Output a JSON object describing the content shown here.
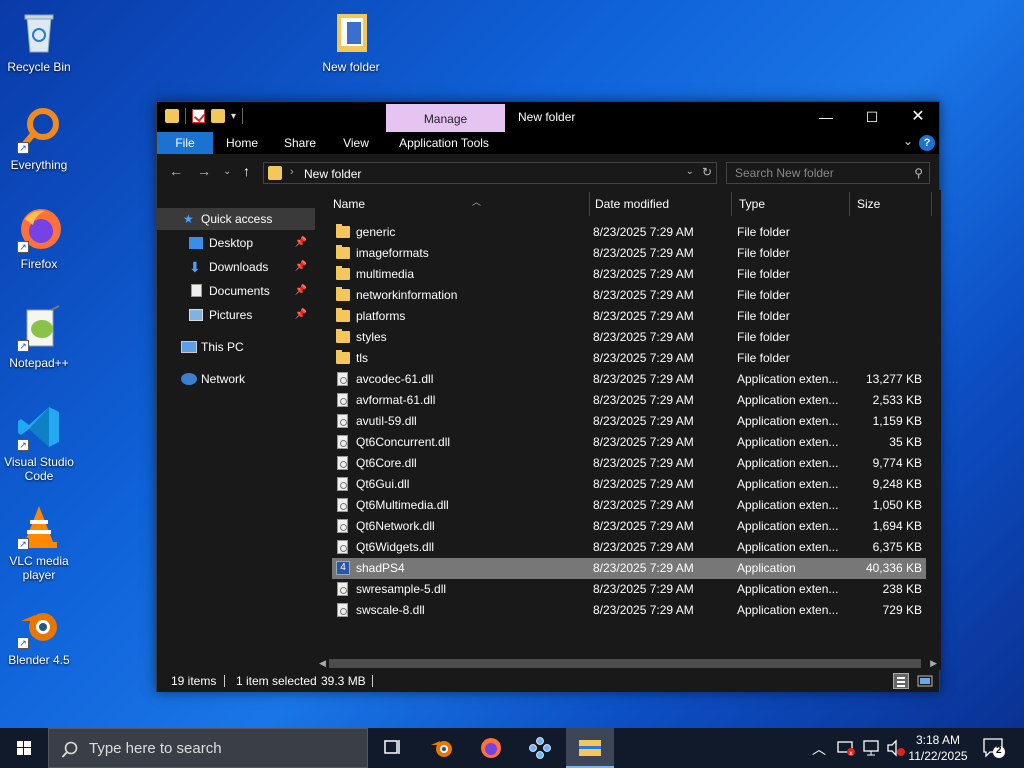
{
  "desktop_icons": [
    {
      "label": "Recycle Bin",
      "icon": "recycle-bin-icon"
    },
    {
      "label": "New folder",
      "icon": "folder-icon"
    },
    {
      "label": "Everything",
      "icon": "everything-search-icon"
    },
    {
      "label": "Firefox",
      "icon": "firefox-icon"
    },
    {
      "label": "Notepad++",
      "icon": "notepadpp-icon"
    },
    {
      "label": "Visual Studio Code",
      "icon": "vscode-icon"
    },
    {
      "label": "VLC media player",
      "icon": "vlc-icon"
    },
    {
      "label": "Blender 4.5",
      "icon": "blender-icon"
    }
  ],
  "window": {
    "title": "New folder",
    "manage_tab": "Manage",
    "ribbon_tabs": [
      "File",
      "Home",
      "Share",
      "View",
      "Application Tools"
    ],
    "address_crumb": "New folder",
    "search_placeholder": "Search New folder",
    "help_glyph": "?"
  },
  "nav_pane": {
    "items": [
      {
        "label": "Quick access",
        "icon": "star-icon",
        "selected": true
      },
      {
        "label": "Desktop",
        "icon": "desktop-icon",
        "pinned": true
      },
      {
        "label": "Downloads",
        "icon": "download-icon",
        "pinned": true
      },
      {
        "label": "Documents",
        "icon": "documents-icon",
        "pinned": true
      },
      {
        "label": "Pictures",
        "icon": "pictures-icon",
        "pinned": true
      },
      {
        "label": "This PC",
        "icon": "computer-icon"
      },
      {
        "label": "Network",
        "icon": "network-icon"
      }
    ]
  },
  "columns": {
    "name": "Name",
    "date": "Date modified",
    "type": "Type",
    "size": "Size"
  },
  "files": [
    {
      "name": "generic",
      "date": "8/23/2025 7:29 AM",
      "type": "File folder",
      "size": "",
      "kind": "folder"
    },
    {
      "name": "imageformats",
      "date": "8/23/2025 7:29 AM",
      "type": "File folder",
      "size": "",
      "kind": "folder"
    },
    {
      "name": "multimedia",
      "date": "8/23/2025 7:29 AM",
      "type": "File folder",
      "size": "",
      "kind": "folder"
    },
    {
      "name": "networkinformation",
      "date": "8/23/2025 7:29 AM",
      "type": "File folder",
      "size": "",
      "kind": "folder"
    },
    {
      "name": "platforms",
      "date": "8/23/2025 7:29 AM",
      "type": "File folder",
      "size": "",
      "kind": "folder"
    },
    {
      "name": "styles",
      "date": "8/23/2025 7:29 AM",
      "type": "File folder",
      "size": "",
      "kind": "folder"
    },
    {
      "name": "tls",
      "date": "8/23/2025 7:29 AM",
      "type": "File folder",
      "size": "",
      "kind": "folder"
    },
    {
      "name": "avcodec-61.dll",
      "date": "8/23/2025 7:29 AM",
      "type": "Application exten...",
      "size": "13,277 KB",
      "kind": "dll"
    },
    {
      "name": "avformat-61.dll",
      "date": "8/23/2025 7:29 AM",
      "type": "Application exten...",
      "size": "2,533 KB",
      "kind": "dll"
    },
    {
      "name": "avutil-59.dll",
      "date": "8/23/2025 7:29 AM",
      "type": "Application exten...",
      "size": "1,159 KB",
      "kind": "dll"
    },
    {
      "name": "Qt6Concurrent.dll",
      "date": "8/23/2025 7:29 AM",
      "type": "Application exten...",
      "size": "35 KB",
      "kind": "dll"
    },
    {
      "name": "Qt6Core.dll",
      "date": "8/23/2025 7:29 AM",
      "type": "Application exten...",
      "size": "9,774 KB",
      "kind": "dll"
    },
    {
      "name": "Qt6Gui.dll",
      "date": "8/23/2025 7:29 AM",
      "type": "Application exten...",
      "size": "9,248 KB",
      "kind": "dll"
    },
    {
      "name": "Qt6Multimedia.dll",
      "date": "8/23/2025 7:29 AM",
      "type": "Application exten...",
      "size": "1,050 KB",
      "kind": "dll"
    },
    {
      "name": "Qt6Network.dll",
      "date": "8/23/2025 7:29 AM",
      "type": "Application exten...",
      "size": "1,694 KB",
      "kind": "dll"
    },
    {
      "name": "Qt6Widgets.dll",
      "date": "8/23/2025 7:29 AM",
      "type": "Application exten...",
      "size": "6,375 KB",
      "kind": "dll"
    },
    {
      "name": "shadPS4",
      "date": "8/23/2025 7:29 AM",
      "type": "Application",
      "size": "40,336 KB",
      "kind": "app",
      "selected": true
    },
    {
      "name": "swresample-5.dll",
      "date": "8/23/2025 7:29 AM",
      "type": "Application exten...",
      "size": "238 KB",
      "kind": "dll"
    },
    {
      "name": "swscale-8.dll",
      "date": "8/23/2025 7:29 AM",
      "type": "Application exten...",
      "size": "729 KB",
      "kind": "dll"
    }
  ],
  "status": {
    "count": "19 items",
    "selection": "1 item selected",
    "size": "39.3 MB"
  },
  "taskbar": {
    "search_placeholder": "Type here to search",
    "apps": [
      "task-view-icon",
      "blender-icon",
      "firefox-icon",
      "ppsspp-icon",
      "file-explorer-icon"
    ],
    "time": "3:18 AM",
    "date": "11/22/2025",
    "notification_count": "2"
  },
  "colors": {
    "accent": "#1a73d0",
    "manage_tab": "#e6c4f2",
    "selected_row": "#777777",
    "folder": "#f3c75a"
  }
}
